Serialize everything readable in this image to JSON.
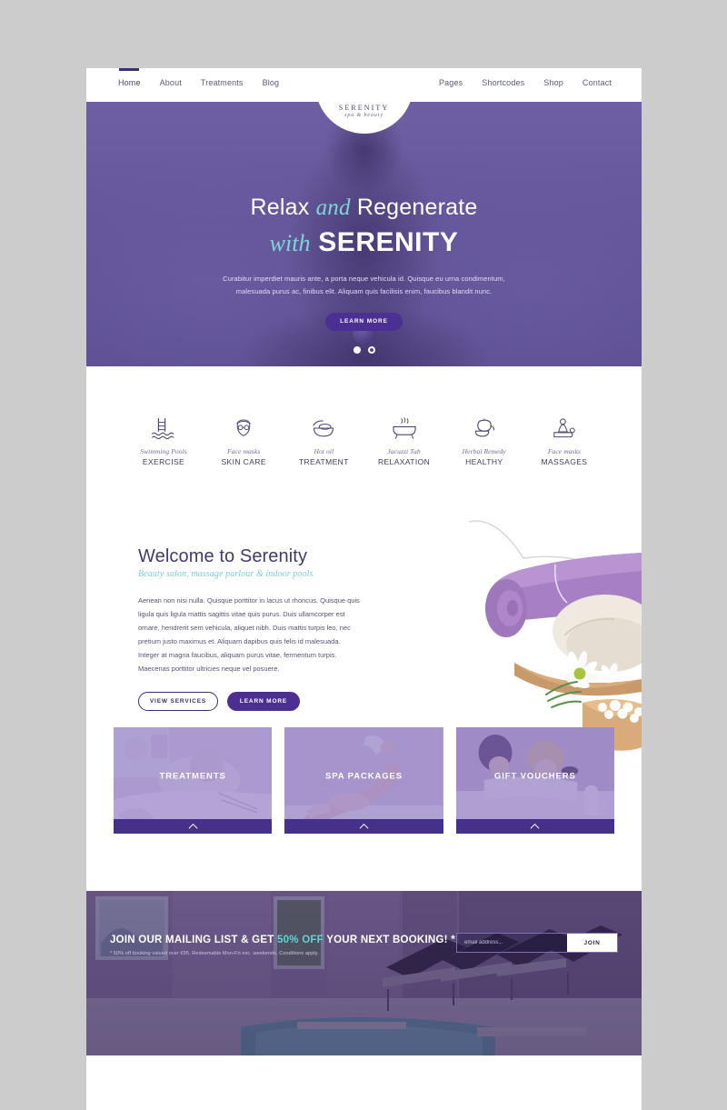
{
  "brand": {
    "name": "SERENITY",
    "tagline": "spa & beauty",
    "logo_icon": "serenity-lotus-icon"
  },
  "nav": {
    "left": [
      {
        "label": "Home",
        "active": true
      },
      {
        "label": "About",
        "active": false
      },
      {
        "label": "Treatments",
        "active": false
      },
      {
        "label": "Blog",
        "active": false
      }
    ],
    "right": [
      {
        "label": "Pages"
      },
      {
        "label": "Shortcodes"
      },
      {
        "label": "Shop"
      },
      {
        "label": "Contact"
      }
    ]
  },
  "hero": {
    "line1_pre": "Relax ",
    "line1_em": "and",
    "line1_post": " Regenerate",
    "line2_em": "with",
    "line2_strong": "SERENITY",
    "description": "Curabitur imperdiet mauris ante, a porta neque vehicula id. Quisque eu urna condimentum, malesuada purus ac, finibus elit. Aliquam quis facilisis enim, faucibus blandit nunc.",
    "cta_label": "LEARN MORE",
    "slides": [
      {
        "index": 1,
        "state": "active"
      },
      {
        "index": 2,
        "state": "inactive"
      }
    ],
    "bg_color": "#6a5b9e"
  },
  "services": [
    {
      "script": "Swimming Pools",
      "label": "EXERCISE",
      "icon": "pool-ladder-icon"
    },
    {
      "script": "Face masks",
      "label": "SKIN CARE",
      "icon": "face-mask-icon"
    },
    {
      "script": "Hot oil",
      "label": "TREATMENT",
      "icon": "hot-oil-bowl-icon"
    },
    {
      "script": "Jacuzzi Tub",
      "label": "RELAXATION",
      "icon": "bathtub-icon"
    },
    {
      "script": "Herbal Remedy",
      "label": "HEALTHY",
      "icon": "herbal-teapot-icon"
    },
    {
      "script": "Face masks",
      "label": "MASSAGES",
      "icon": "massage-icon"
    }
  ],
  "welcome": {
    "heading": "Welcome to Serenity",
    "subheading": "Beauty salon, massage parlour & indoor pools",
    "body": "Aenean non nisi nulla. Quisque porttitor in lacus ut rhoncus. Quisque quis ligula quis ligula mattis sagittis vitae quis purus. Duis ullamcorper est ornare, hendrerit sem vehicula, aliquet nibh. Duis mattis turpis leo, nec pretium justo maximus et. Aliquam dapibus quis felis id malesuada. Integer at magna faucibus, aliquam purus vitae, fermentum turpis. Maecenas porttitor ultricies neque vel posuere.",
    "btn_outline": "VIEW SERVICES",
    "btn_solid": "LEARN MORE",
    "image_alt": "rolled-purple-towel-with-daisy"
  },
  "cards": [
    {
      "title": "TREATMENTS",
      "image_alt": "facial-treatment-photo",
      "chevron": "chevron-up-icon"
    },
    {
      "title": "SPA PACKAGES",
      "image_alt": "leg-massage-photo",
      "chevron": "chevron-up-icon"
    },
    {
      "title": "GIFT VOUCHERS",
      "image_alt": "couples-massage-photo",
      "chevron": "chevron-up-icon"
    }
  ],
  "newsletter": {
    "head_pre": "JOIN OUR MAILING LIST & GET ",
    "head_highlight": "50% OFF",
    "head_post": " YOUR NEXT BOOKING! *",
    "fine_print": "* 50% off booking valued over €95. Redeemable Mon-Fri exc. weekends. Conditions apply.",
    "input_placeholder": "email address...",
    "input_value": "",
    "join_label": "JOIN",
    "highlight_color": "#5fd3d8",
    "image_alt": "indoor-pool-with-loungers-photo"
  }
}
